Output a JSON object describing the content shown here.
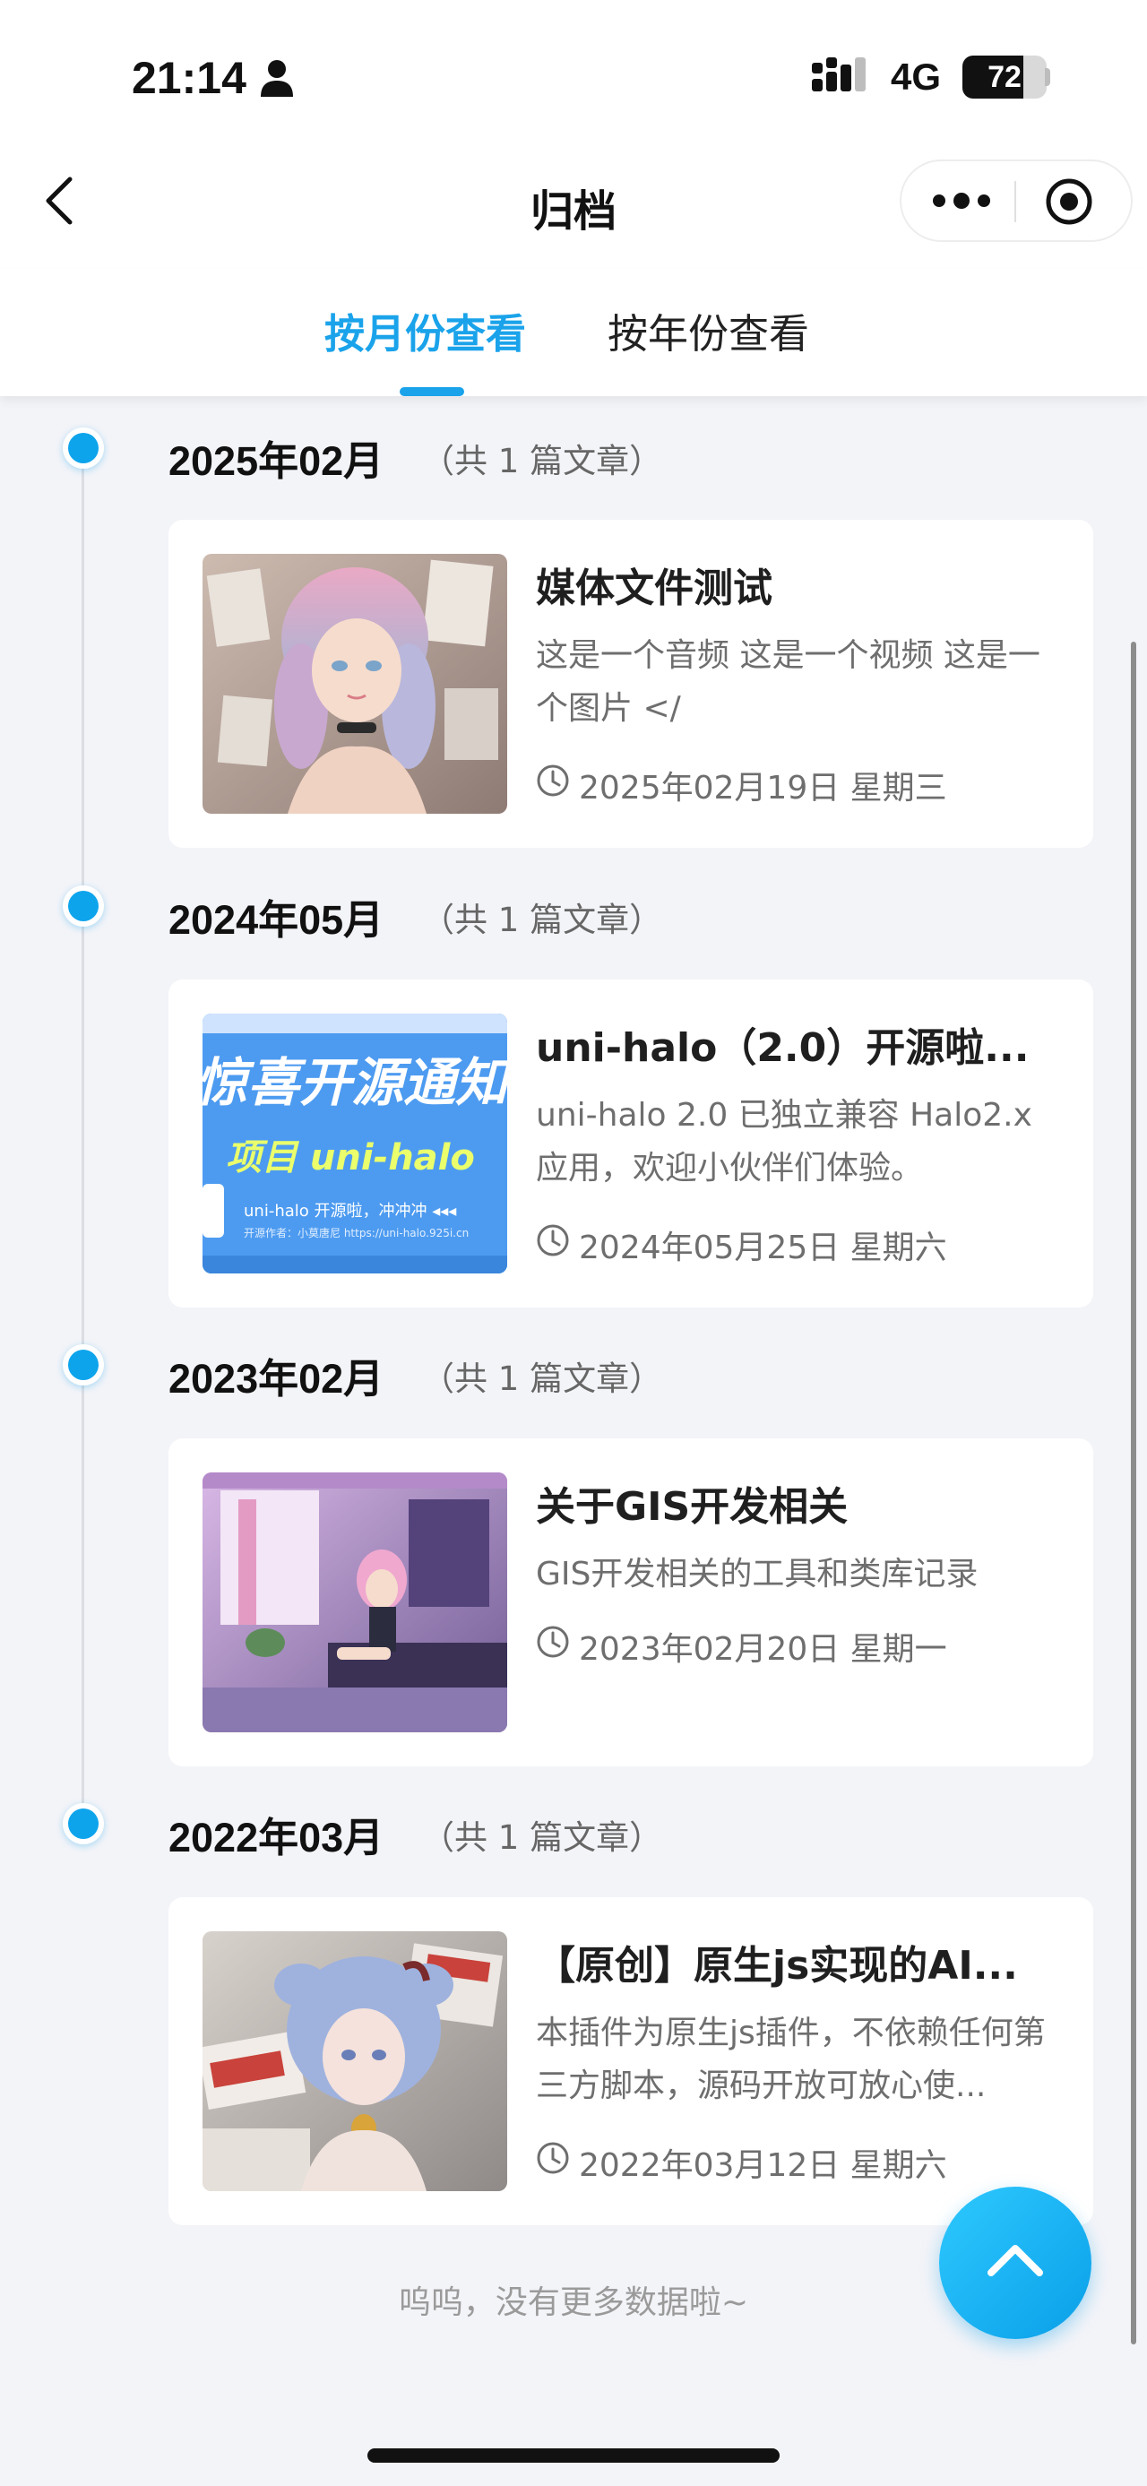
{
  "status_bar": {
    "time": "21:14",
    "network": "4G",
    "battery": "72",
    "battery_level": 0.72,
    "icons": [
      "person-icon",
      "signal-icon",
      "battery-icon"
    ]
  },
  "nav": {
    "title": "归档",
    "icons": [
      "back-icon",
      "more-icon",
      "close-circle-icon"
    ]
  },
  "tabs": [
    {
      "label": "按月份查看",
      "active": true
    },
    {
      "label": "按年份查看",
      "active": false
    }
  ],
  "colors": {
    "accent": "#1aa3ea",
    "background": "#f3f4f8"
  },
  "groups": [
    {
      "title": "2025年02月",
      "count": "（共 1 篇文章）",
      "post": {
        "title": "媒体文件测试",
        "desc": "这是一个音频 这是一个视频 这是一个图片 </",
        "date": "2025年02月19日  星期三"
      }
    },
    {
      "title": "2024年05月",
      "count": "（共 1 篇文章）",
      "post": {
        "title": "uni-halo（2.0）开源啦...",
        "desc": "uni-halo 2.0 已独立兼容 Halo2.x 应用，欢迎小伙伴们体验。",
        "date": "2024年05月25日  星期六",
        "thumb_text": {
          "line1": "惊喜开源通知",
          "line2": "项目 uni-halo",
          "line3": "uni-halo 开源啦，冲冲冲 ◂◂◂",
          "line4": "开源作者：小莫唐尼  https://uni-halo.925i.cn"
        }
      }
    },
    {
      "title": "2023年02月",
      "count": "（共 1 篇文章）",
      "post": {
        "title": "关于GIS开发相关",
        "desc": "GIS开发相关的工具和类库记录",
        "date": "2023年02月20日  星期一"
      }
    },
    {
      "title": "2022年03月",
      "count": "（共 1 篇文章）",
      "post": {
        "title": "【原创】原生js实现的AI...",
        "desc": "本插件为原生js插件，不依赖任何第三方脚本，源码开放可放心使...",
        "date": "2022年03月12日  星期六"
      }
    }
  ],
  "footer": {
    "no_more": "呜呜，没有更多数据啦~"
  }
}
